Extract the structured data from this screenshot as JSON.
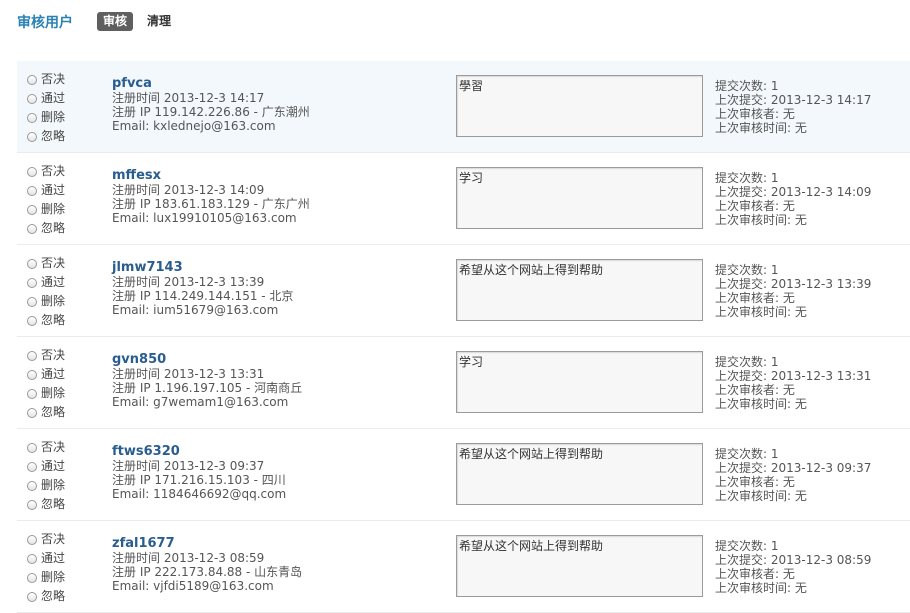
{
  "header": {
    "title": "审核用户",
    "tabs": [
      {
        "label": "审核"
      },
      {
        "label": "清理"
      }
    ]
  },
  "actions": [
    "否决",
    "通过",
    "删除",
    "忽略"
  ],
  "users": [
    {
      "username": "pfvca",
      "reg_time": "注册时间 2013-12-3 14:17",
      "reg_ip": "注册 IP 119.142.226.86 - 广东潮州",
      "email": "Email: kxlednejo@163.com",
      "reason": "學習",
      "submit_count": "提交次数: 1",
      "last_submit": "上次提交: 2013-12-3 14:17",
      "last_reviewer": "上次审核者: 无",
      "last_review_time": "上次审核时间: 无"
    },
    {
      "username": "mffesx",
      "reg_time": "注册时间 2013-12-3 14:09",
      "reg_ip": "注册 IP 183.61.183.129 - 广东广州",
      "email": "Email: lux19910105@163.com",
      "reason": "学习",
      "submit_count": "提交次数: 1",
      "last_submit": "上次提交: 2013-12-3 14:09",
      "last_reviewer": "上次审核者: 无",
      "last_review_time": "上次审核时间: 无"
    },
    {
      "username": "jlmw7143",
      "reg_time": "注册时间 2013-12-3 13:39",
      "reg_ip": "注册 IP 114.249.144.151 - 北京",
      "email": "Email: ium51679@163.com",
      "reason": "希望从这个网站上得到帮助",
      "submit_count": "提交次数: 1",
      "last_submit": "上次提交: 2013-12-3 13:39",
      "last_reviewer": "上次审核者: 无",
      "last_review_time": "上次审核时间: 无"
    },
    {
      "username": "gvn850",
      "reg_time": "注册时间 2013-12-3 13:31",
      "reg_ip": "注册 IP 1.196.197.105 - 河南商丘",
      "email": "Email: g7wemam1@163.com",
      "reason": "学习",
      "submit_count": "提交次数: 1",
      "last_submit": "上次提交: 2013-12-3 13:31",
      "last_reviewer": "上次审核者: 无",
      "last_review_time": "上次审核时间: 无"
    },
    {
      "username": "ftws6320",
      "reg_time": "注册时间 2013-12-3 09:37",
      "reg_ip": "注册 IP 171.216.15.103 - 四川",
      "email": "Email: 1184646692@qq.com",
      "reason": "希望从这个网站上得到帮助",
      "submit_count": "提交次数: 1",
      "last_submit": "上次提交: 2013-12-3 09:37",
      "last_reviewer": "上次审核者: 无",
      "last_review_time": "上次审核时间: 无"
    },
    {
      "username": "zfal1677",
      "reg_time": "注册时间 2013-12-3 08:59",
      "reg_ip": "注册 IP 222.173.84.88 - 山东青岛",
      "email": "Email: vjfdi5189@163.com",
      "reason": "希望从这个网站上得到帮助",
      "submit_count": "提交次数: 1",
      "last_submit": "上次提交: 2013-12-3 08:59",
      "last_reviewer": "上次审核者: 无",
      "last_review_time": "上次审核时间: 无"
    }
  ]
}
